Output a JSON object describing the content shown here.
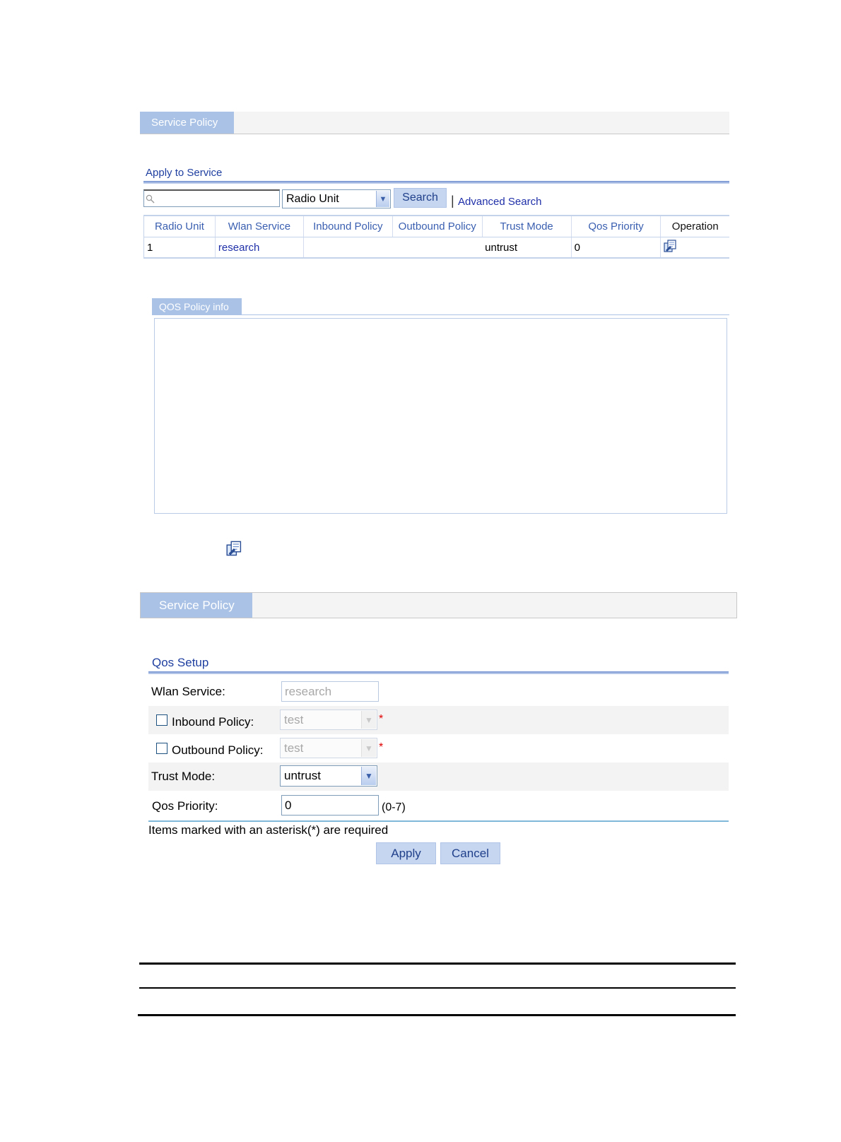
{
  "top": {
    "tab_label": "Service Policy",
    "section_title": "Apply to Service",
    "search": {
      "placeholder": "",
      "field_select": "Radio Unit",
      "search_button": "Search",
      "separator": "|",
      "advanced_search": "Advanced Search"
    },
    "table": {
      "columns": [
        "Radio Unit",
        "Wlan Service",
        "Inbound Policy",
        "Outbound Policy",
        "Trust Mode",
        "Qos Priority",
        "Operation"
      ],
      "rows": [
        {
          "radio_unit": "1",
          "wlan_service": "research",
          "inbound_policy": "",
          "outbound_policy": "",
          "trust_mode": "untrust",
          "qos_priority": "0",
          "operation_icon": "edit-icon"
        }
      ]
    },
    "info_tab_label": "QOS Policy info"
  },
  "bottom": {
    "tab_label": "Service Policy",
    "section_title": "Qos Setup",
    "form": {
      "wlan_service_label": "Wlan Service:",
      "wlan_service_value": "research",
      "inbound_label": "Inbound Policy:",
      "inbound_value": "test",
      "outbound_label": "Outbound Policy:",
      "outbound_value": "test",
      "required_mark": "*",
      "trust_mode_label": "Trust Mode:",
      "trust_mode_value": "untrust",
      "qos_priority_label": "Qos Priority:",
      "qos_priority_value": "0",
      "qos_priority_range": "(0-7)"
    },
    "note": "Items marked with an asterisk(*) are required",
    "apply_button": "Apply",
    "cancel_button": "Cancel"
  },
  "icons": {
    "operation": "edit-icon",
    "search": "search-icon",
    "dropdown": "chevron-down-icon"
  },
  "colors": {
    "tab_bg": "#a9c2e6",
    "link": "#1f2fa8",
    "header_text": "#3a5fb0",
    "required": "#e00000"
  }
}
